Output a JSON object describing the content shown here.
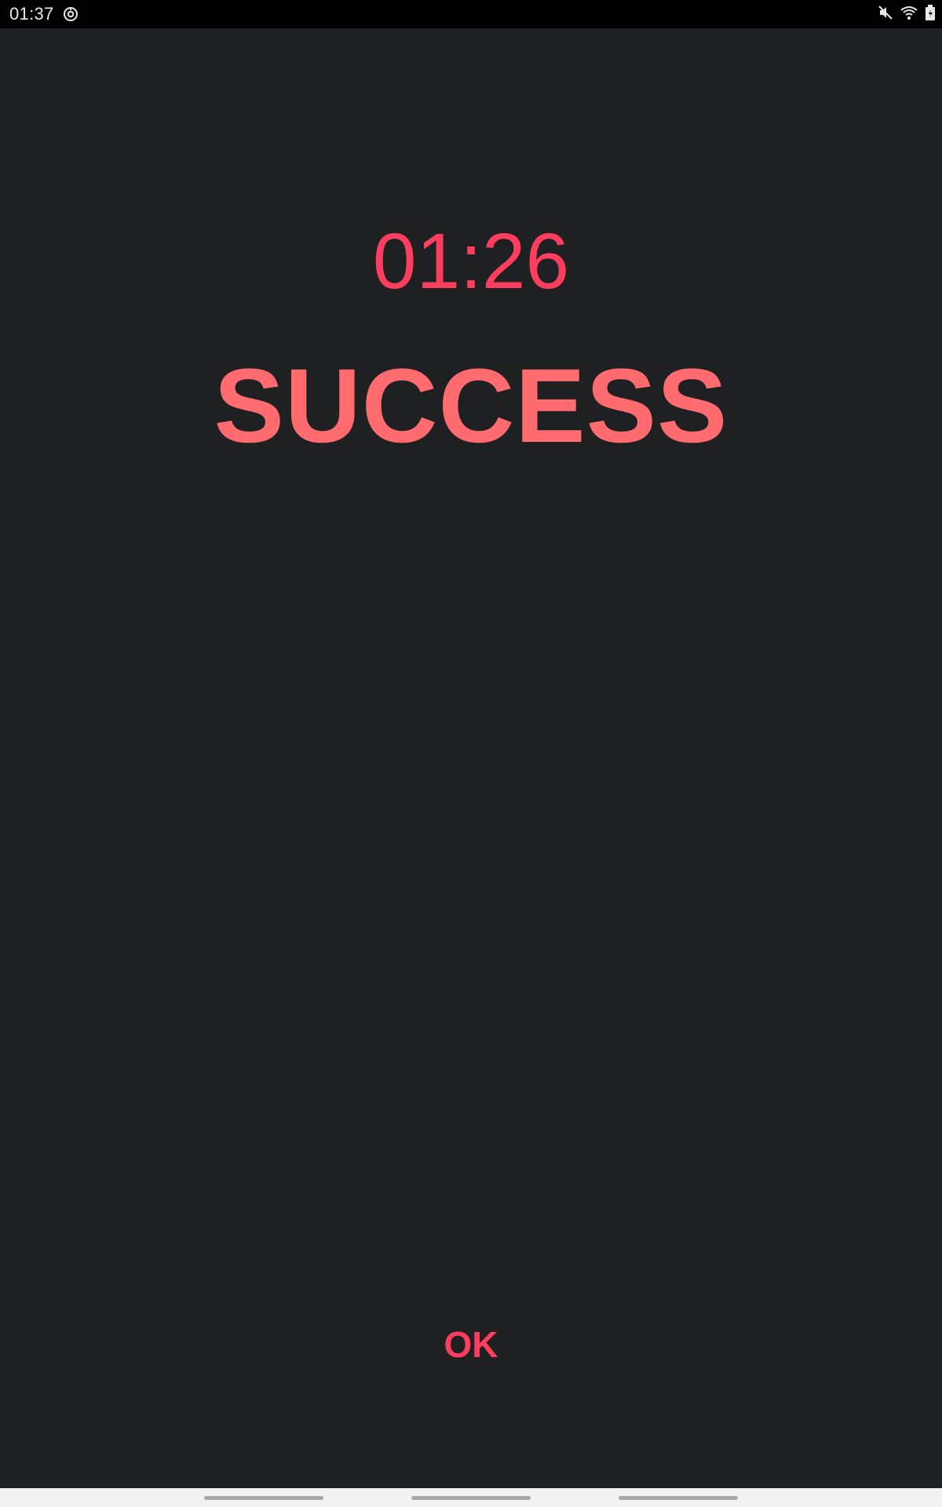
{
  "status_bar": {
    "time": "01:37",
    "left_icon": "sync-app-icon",
    "right_icons": [
      "mute-icon",
      "wifi-icon",
      "battery-icon"
    ]
  },
  "timer": {
    "value": "01:26",
    "color": "#ff3e5f"
  },
  "result": {
    "label": "SUCCESS",
    "color": "#ff6b6f"
  },
  "ok_button": {
    "label": "OK",
    "color": "#ff3e5f"
  },
  "background_color": "#1f2022",
  "navigation_bar": {
    "handles": [
      "nav-handle-left",
      "nav-handle-center",
      "nav-handle-right"
    ]
  }
}
